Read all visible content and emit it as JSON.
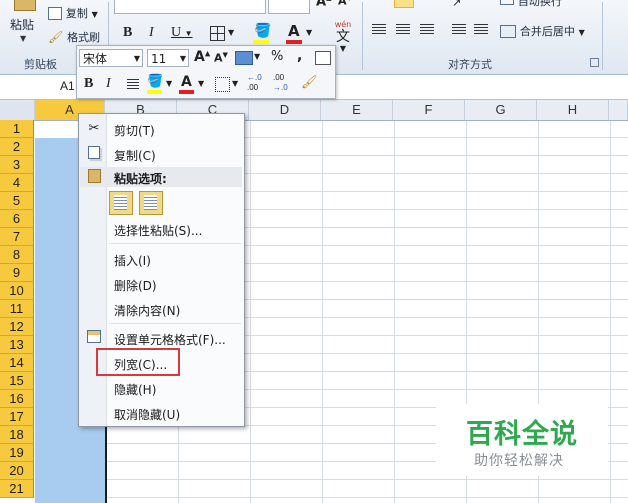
{
  "ribbon": {
    "paste_label": "粘贴",
    "copy_label": "复制",
    "format_painter_label": "格式刷",
    "clipboard_group_label": "剪贴板",
    "wrap_text_label": "自动换行",
    "merge_center_label": "合并后居中",
    "alignment_group_label": "对齐方式",
    "font_name_partial": "宋体",
    "wen_label": "wén",
    "wen_char": "文"
  },
  "mini_toolbar": {
    "font_name": "宋体",
    "font_size": "11",
    "grow_font": "A",
    "shrink_font": "A",
    "percent": "%",
    "comma": ",",
    "bold": "B",
    "italic": "I",
    "inc_decimal_top": "←.0",
    "inc_decimal_bottom": ".00",
    "dec_decimal_top": ".00",
    "dec_decimal_bottom": "→.0"
  },
  "formula_bar": {
    "name_box": "A1"
  },
  "columns": [
    "A",
    "B",
    "C",
    "D",
    "E",
    "F",
    "G",
    "H"
  ],
  "rows": [
    "1",
    "2",
    "3",
    "4",
    "5",
    "6",
    "7",
    "8",
    "9",
    "10",
    "11",
    "12",
    "13",
    "14",
    "15",
    "16",
    "17",
    "18",
    "19",
    "20",
    "21"
  ],
  "context_menu": {
    "cut": "剪切(T)",
    "copy": "复制(C)",
    "paste_options": "粘贴选项:",
    "paste_special": "选择性粘贴(S)...",
    "insert": "插入(I)",
    "delete": "删除(D)",
    "clear_contents": "清除内容(N)",
    "format_cells": "设置单元格格式(F)...",
    "column_width": "列宽(C)...",
    "hide": "隐藏(H)",
    "unhide": "取消隐藏(U)"
  },
  "watermark": {
    "title": "百科全说",
    "subtitle": "助你轻松解决"
  },
  "colors": {
    "selection": "#a8cbf0",
    "row_header_selected": "#f7c93f",
    "highlight_box": "#d9393e",
    "watermark_green": "#2fa84f"
  }
}
